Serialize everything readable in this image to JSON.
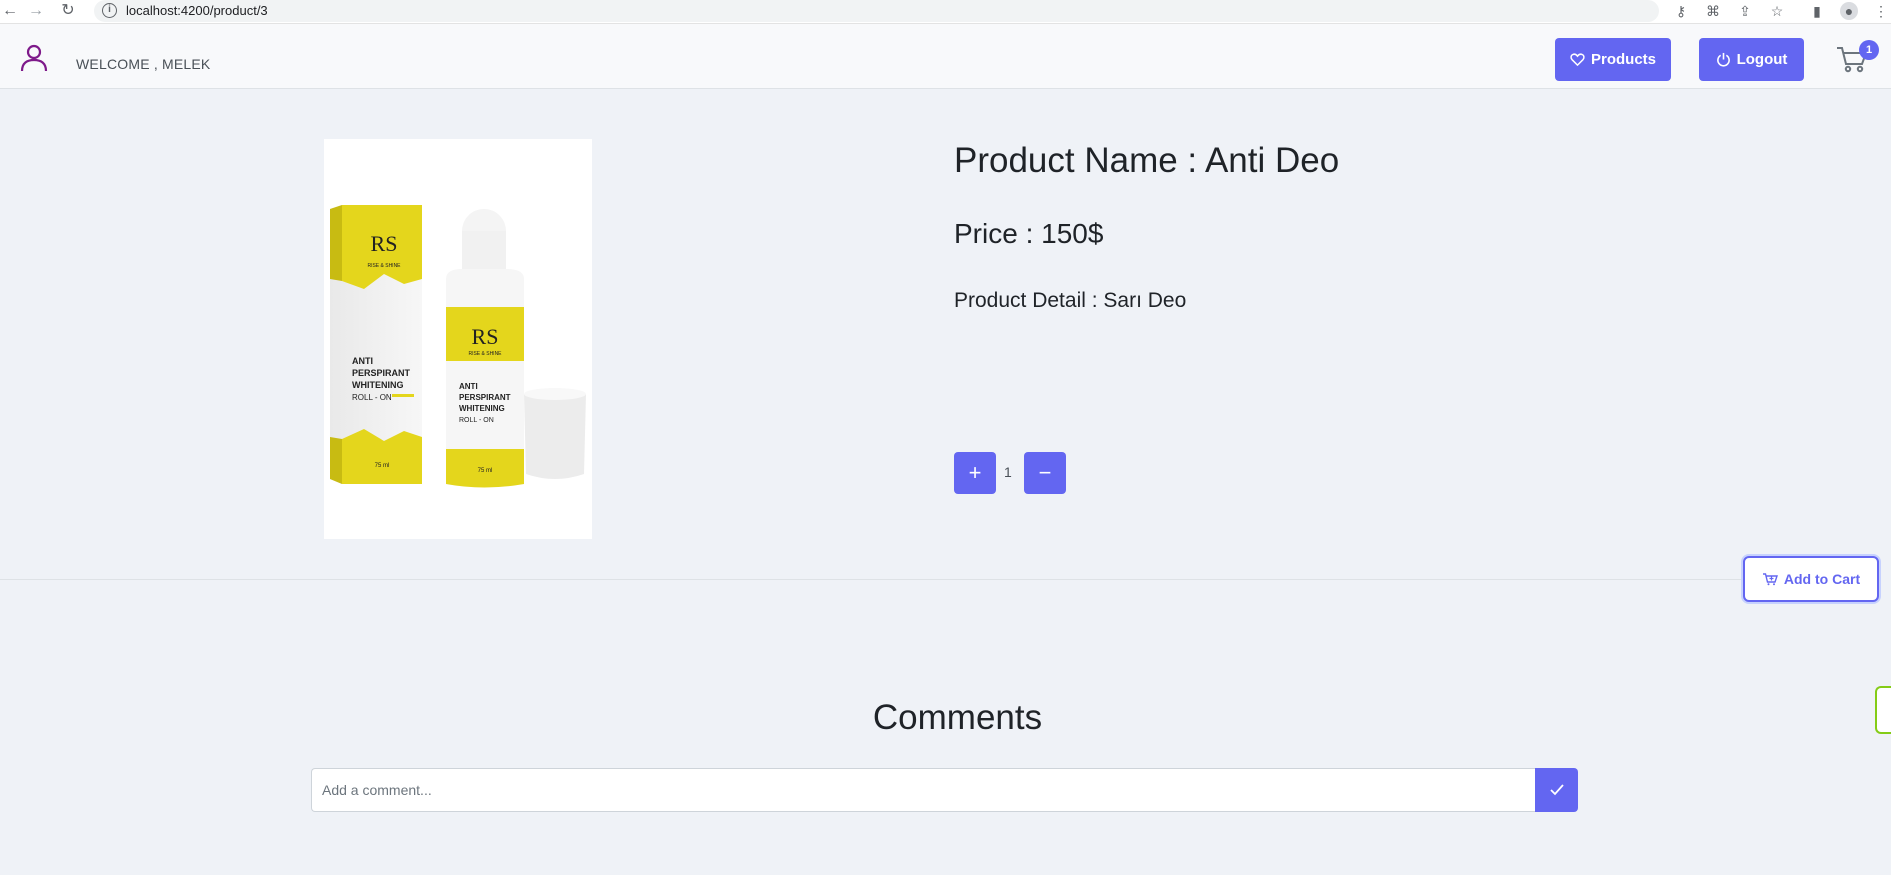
{
  "browser": {
    "url": "localhost:4200/product/3"
  },
  "header": {
    "welcome_text": "WELCOME , MELEK",
    "products_label": "Products",
    "logout_label": "Logout",
    "cart_count": "1"
  },
  "product": {
    "name": "Product Name : Anti Deo",
    "price": "Price : 150$",
    "detail": "Product Detail : Sarı Deo",
    "quantity": "1",
    "add_to_cart_label": "Add to Cart",
    "image_label": {
      "brand": "RS",
      "tagline": "RISE & SHINE",
      "line1": "ANTI",
      "line2": "PERSPIRANT",
      "line3": "WHITENING",
      "line4": "ROLL - ON",
      "volume": "75 ml"
    }
  },
  "comments": {
    "title": "Comments",
    "placeholder": "Add a comment..."
  },
  "colors": {
    "accent": "#6366f1",
    "page_bg": "#eff2f7",
    "user_icon": "#7e1a8a",
    "label_yellow": "#e4d61c"
  }
}
